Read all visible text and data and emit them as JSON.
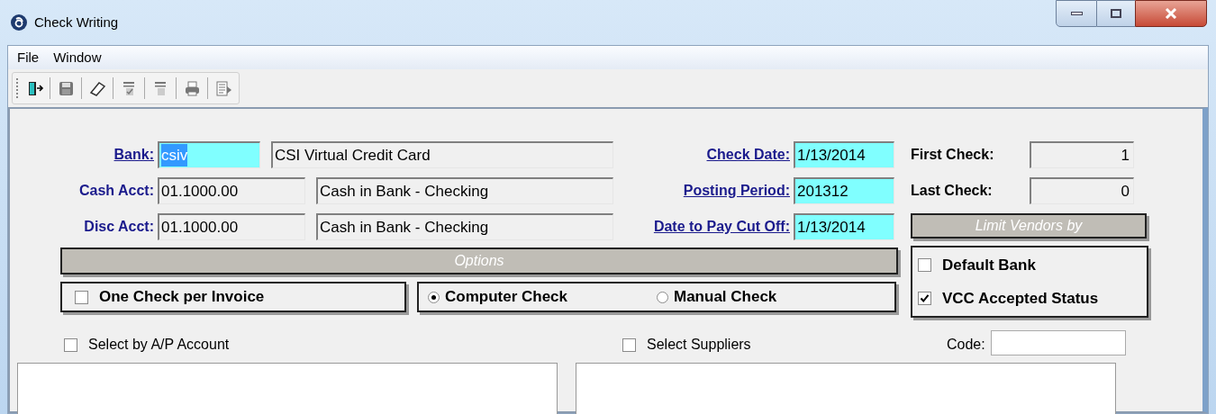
{
  "window": {
    "title": "Check Writing"
  },
  "menu": [
    {
      "label": "File"
    },
    {
      "label": "Window"
    }
  ],
  "account_fields": [
    {
      "label": "Bank:",
      "kind": "link",
      "value": "csiv",
      "value_selected": true,
      "editable": true,
      "description": "CSI Virtual Credit Card"
    },
    {
      "label": "Cash Acct:",
      "kind": "plain",
      "value": "01.1000.00",
      "value_selected": false,
      "editable": false,
      "description": "Cash in Bank - Checking"
    },
    {
      "label": "Disc Acct:",
      "kind": "plain",
      "value": "01.1000.00",
      "value_selected": false,
      "editable": false,
      "description": "Cash in Bank - Checking"
    }
  ],
  "date_fields": [
    {
      "label": "Check Date:",
      "value": "1/13/2014"
    },
    {
      "label": "Posting Period:",
      "value": "201312"
    },
    {
      "label": "Date to Pay Cut Off:",
      "value": "1/13/2014"
    }
  ],
  "check_numbers": [
    {
      "label": "First Check:",
      "value": "1"
    },
    {
      "label": "Last Check:",
      "value": "0"
    }
  ],
  "limit_vendors": {
    "title": "Limit Vendors by",
    "options": [
      {
        "label": "Default Bank",
        "checked": false
      },
      {
        "label": "VCC Accepted Status",
        "checked": true
      }
    ]
  },
  "options": {
    "title": "Options",
    "one_check_per_invoice": {
      "label": "One Check per Invoice",
      "checked": false
    },
    "check_types": [
      {
        "label": "Computer Check",
        "selected": true
      },
      {
        "label": "Manual Check",
        "selected": false
      }
    ]
  },
  "select_ap_account": {
    "label": "Select by A/P Account",
    "checked": false
  },
  "select_suppliers": {
    "label": "Select Suppliers",
    "checked": false
  },
  "code": {
    "label": "Code:"
  }
}
